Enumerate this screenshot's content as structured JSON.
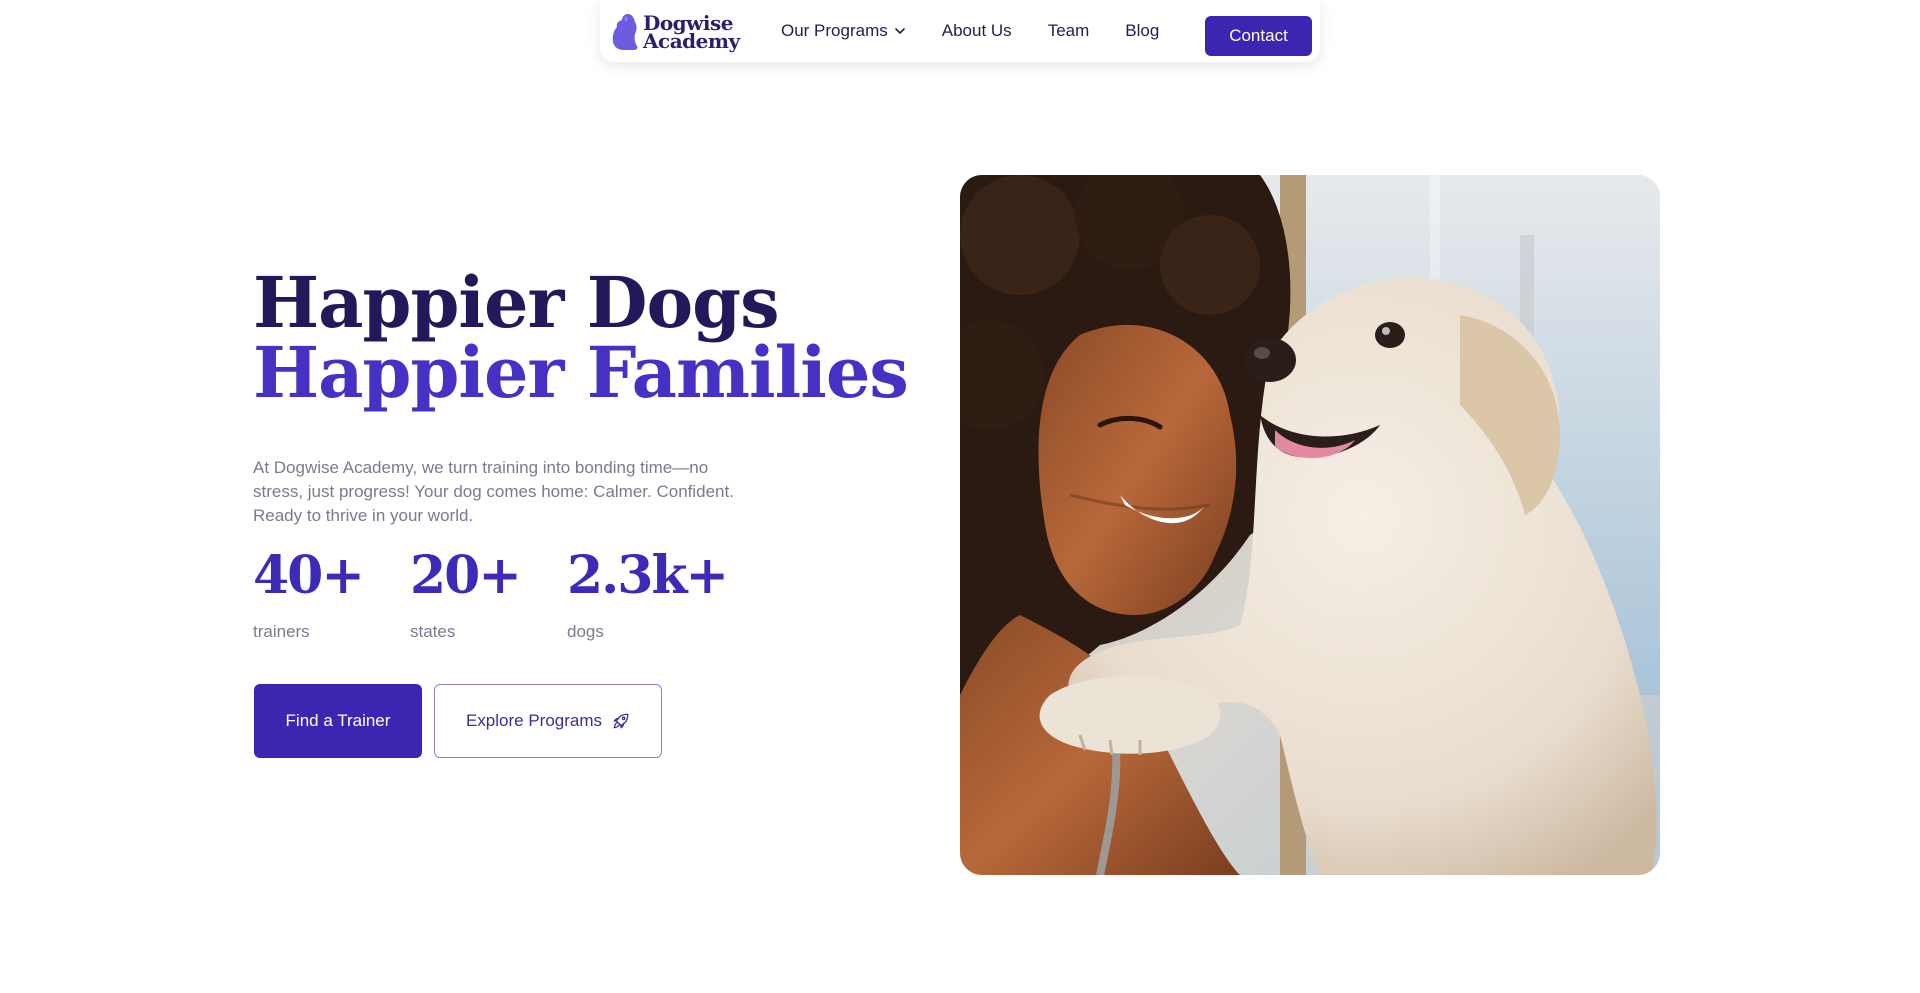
{
  "brand": {
    "name_line1": "Dogwise",
    "name_line2": "Academy",
    "logo_icon": "dog-silhouette-icon",
    "accent_color": "#3a26b0"
  },
  "nav": {
    "items": [
      {
        "label": "Our Programs",
        "has_dropdown": true,
        "icon": "chevron-down-icon"
      },
      {
        "label": "About Us"
      },
      {
        "label": "Team"
      },
      {
        "label": "Blog"
      }
    ],
    "contact_label": "Contact"
  },
  "hero": {
    "title_line1": "Happier Dogs",
    "title_line2": "Happier Families",
    "description": "At Dogwise Academy, we turn training into bonding time—no stress, just progress! Your dog comes home: Calmer. Confident. Ready to thrive in your world.",
    "stats": [
      {
        "value": "40+",
        "label": "trainers"
      },
      {
        "value": "20+",
        "label": "states"
      },
      {
        "value": "2.3k+",
        "label": "dogs"
      }
    ],
    "primary_cta": "Find a Trainer",
    "secondary_cta": "Explore Programs",
    "secondary_cta_icon": "rocket-icon"
  },
  "image": {
    "subject": "hero-photo",
    "colors": {
      "heading_dark": "#21195a",
      "heading_accent": "#4531c4",
      "muted_text": "#7b7a8f"
    }
  }
}
